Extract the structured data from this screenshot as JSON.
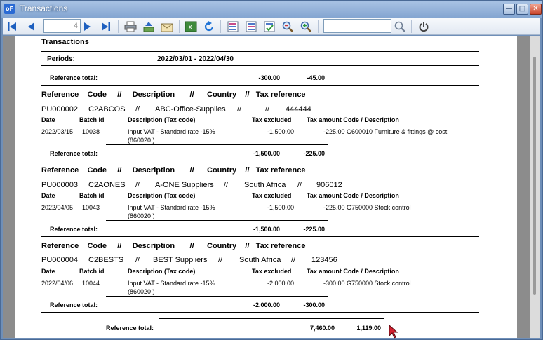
{
  "window": {
    "title": "Transactions",
    "app_icon": "oF"
  },
  "toolbar": {
    "page_number": "4",
    "search_value": ""
  },
  "report": {
    "title": "Transactions",
    "periods_label": "Periods:",
    "periods_value": "2022/03/01 -  2022/04/30",
    "top_total": {
      "label": "Reference total:",
      "excluded": "-300.00",
      "tax": "-45.00"
    },
    "header_labels": {
      "reference": "Reference",
      "code": "Code",
      "sep": "//",
      "description": "Description",
      "country": "Country",
      "tax_reference": "Tax reference"
    },
    "column_labels": {
      "date": "Date",
      "batch": "Batch id",
      "desc": "Description (Tax code)",
      "excluded": "Tax excluded",
      "tax_amount": "Tax amount Code / Description"
    },
    "groups": [
      {
        "reference": "PU000002",
        "code": "C2ABCOS",
        "description": "ABC-Office-Supplies",
        "country": "",
        "tax_reference": "444444",
        "row": {
          "date": "2022/03/15",
          "batch": "10038",
          "desc1": "Input VAT - Standard rate -15%",
          "desc2": "(860020 )",
          "excluded": "-1,500.00",
          "tax": "-225.00 G600010  Furniture & fittings @ cost"
        },
        "total": {
          "label": "Reference total:",
          "excluded": "-1,500.00",
          "tax": "-225.00"
        }
      },
      {
        "reference": "PU000003",
        "code": "C2AONES",
        "description": "A-ONE Suppliers",
        "country": "South Africa",
        "tax_reference": "906012",
        "row": {
          "date": "2022/04/05",
          "batch": "10043",
          "desc1": "Input VAT - Standard rate -15%",
          "desc2": "(860020 )",
          "excluded": "-1,500.00",
          "tax": "-225.00 G750000  Stock control"
        },
        "total": {
          "label": "Reference total:",
          "excluded": "-1,500.00",
          "tax": "-225.00"
        }
      },
      {
        "reference": "PU000004",
        "code": "C2BESTS",
        "description": "BEST Suppliers",
        "country": "South Africa",
        "tax_reference": "123456",
        "row": {
          "date": "2022/04/06",
          "batch": "10044",
          "desc1": "Input VAT - Standard rate -15%",
          "desc2": "(860020 )",
          "excluded": "-2,000.00",
          "tax": "-300.00 G750000  Stock control"
        },
        "total": {
          "label": "Reference total:",
          "excluded": "-2,000.00",
          "tax": "-300.00"
        }
      }
    ],
    "grand_total": {
      "label": "Reference total:",
      "excluded": "7,460.00",
      "tax": "1,119.00"
    }
  }
}
